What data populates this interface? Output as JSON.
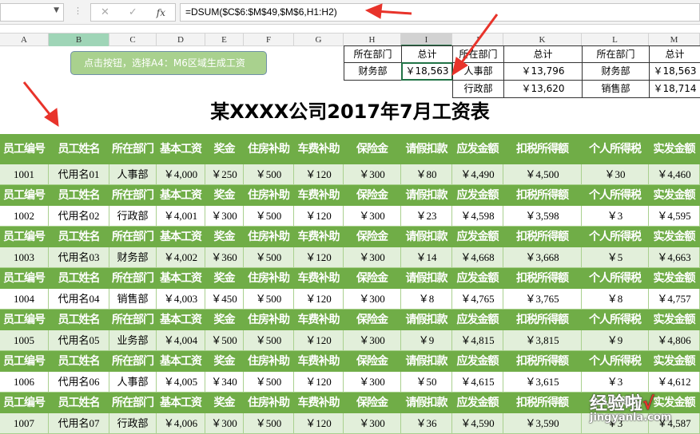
{
  "formula_bar": {
    "name_box": "",
    "cancel_icon": "✕",
    "enter_icon": "✓",
    "fx_label": "fx",
    "formula": "=DSUM($C$6:$M$49,$M$6,H1:H2)"
  },
  "columns": [
    "A",
    "B",
    "C",
    "D",
    "E",
    "F",
    "G",
    "H",
    "I",
    "J",
    "K",
    "L",
    "M"
  ],
  "selected_column": "I",
  "button": {
    "label": "点击按钮，选择A4：M6区域生成工资"
  },
  "criteria_tables": [
    {
      "header": [
        "所在部门",
        "总计"
      ],
      "rows": [
        [
          "财务部",
          "￥18,563"
        ]
      ]
    },
    {
      "header": [
        "所在部门",
        "总计"
      ],
      "rows": [
        [
          "人事部",
          "￥13,796"
        ],
        [
          "行政部",
          "￥13,620"
        ]
      ]
    },
    {
      "header": [
        "所在部门",
        "总计"
      ],
      "rows": [
        [
          "财务部",
          "￥18,563"
        ],
        [
          "销售部",
          "￥18,714"
        ]
      ]
    }
  ],
  "title": "某XXXX公司2017年7月工资表",
  "table": {
    "headers": [
      "员工编号",
      "员工姓名",
      "所在部门",
      "基本工资",
      "奖金",
      "住房补助",
      "车费补助",
      "保险金",
      "请假扣款",
      "应发金额",
      "扣税所得额",
      "个人所得税",
      "实发金额"
    ],
    "rows": [
      [
        "1001",
        "代用名01",
        "人事部",
        "￥4,000",
        "￥250",
        "￥500",
        "￥120",
        "￥300",
        "￥80",
        "￥4,490",
        "￥4,500",
        "￥30",
        "￥4,460"
      ],
      [
        "1002",
        "代用名02",
        "行政部",
        "￥4,001",
        "￥300",
        "￥500",
        "￥120",
        "￥300",
        "￥23",
        "￥4,598",
        "￥3,598",
        "￥3",
        "￥4,595"
      ],
      [
        "1003",
        "代用名03",
        "财务部",
        "￥4,002",
        "￥360",
        "￥500",
        "￥120",
        "￥300",
        "￥14",
        "￥4,668",
        "￥3,668",
        "￥5",
        "￥4,663"
      ],
      [
        "1004",
        "代用名04",
        "销售部",
        "￥4,003",
        "￥450",
        "￥500",
        "￥120",
        "￥300",
        "￥8",
        "￥4,765",
        "￥3,765",
        "￥8",
        "￥4,757"
      ],
      [
        "1005",
        "代用名05",
        "业务部",
        "￥4,004",
        "￥500",
        "￥500",
        "￥120",
        "￥300",
        "￥9",
        "￥4,815",
        "￥3,815",
        "￥9",
        "￥4,806"
      ],
      [
        "1006",
        "代用名06",
        "人事部",
        "￥4,005",
        "￥340",
        "￥500",
        "￥120",
        "￥300",
        "￥50",
        "￥4,615",
        "￥3,615",
        "￥3",
        "￥4,612"
      ],
      [
        "1007",
        "代用名07",
        "行政部",
        "￥4,006",
        "￥300",
        "￥500",
        "￥120",
        "￥300",
        "￥36",
        "￥4,590",
        "￥3,590",
        "￥3",
        "￥4,587"
      ]
    ]
  },
  "watermark": {
    "text": "经验啦",
    "check": "√",
    "url": "jingyanla.com"
  },
  "colors": {
    "header_green": "#70ad47",
    "row_light_green": "#e2efda",
    "button_green": "#a9d18e",
    "arrow_red": "#e8332a",
    "selection_green": "#217346"
  }
}
